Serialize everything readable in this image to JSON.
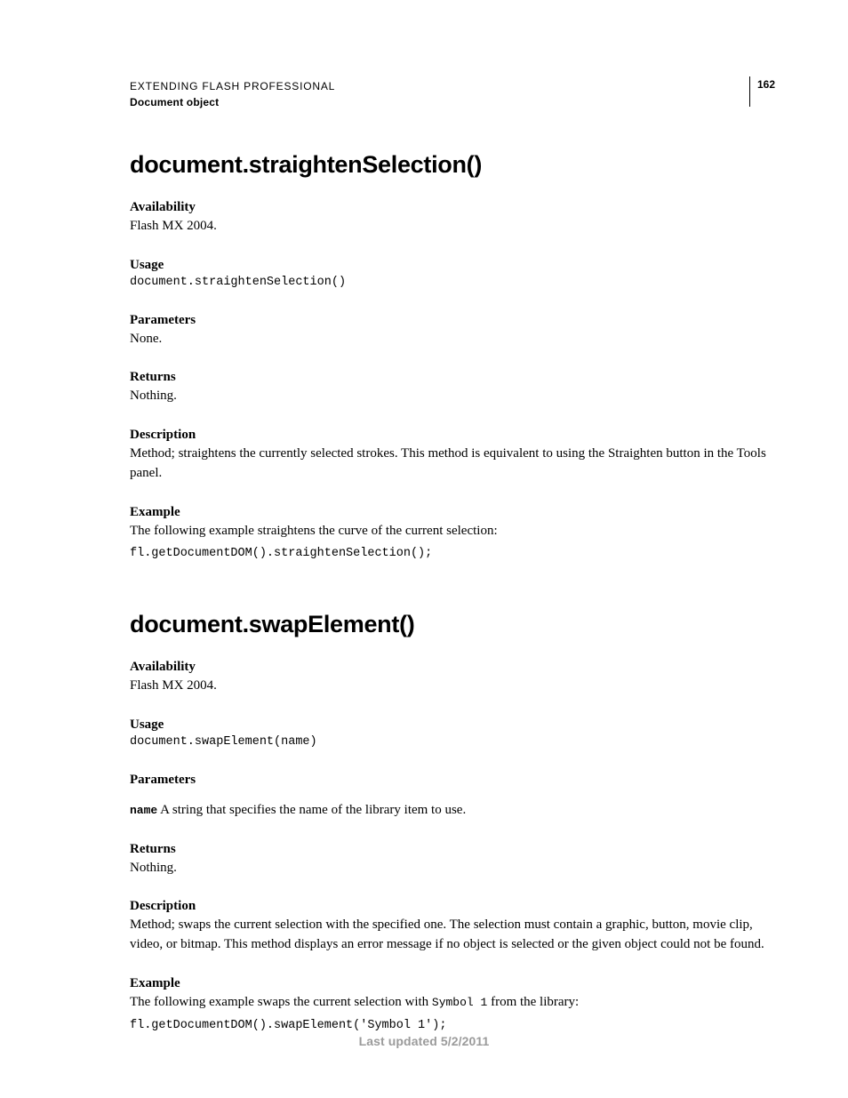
{
  "header": {
    "title": "EXTENDING FLASH PROFESSIONAL",
    "sub": "Document object",
    "page_number": "162"
  },
  "section1": {
    "heading": "document.straightenSelection()",
    "availability_label": "Availability",
    "availability_text": "Flash MX 2004.",
    "usage_label": "Usage",
    "usage_code": "document.straightenSelection()",
    "parameters_label": "Parameters",
    "parameters_text": "None.",
    "returns_label": "Returns",
    "returns_text": "Nothing.",
    "description_label": "Description",
    "description_text": "Method; straightens the currently selected strokes. This method is equivalent to using the Straighten button in the Tools panel.",
    "example_label": "Example",
    "example_text": "The following example straightens the curve of the current selection:",
    "example_code": "fl.getDocumentDOM().straightenSelection();"
  },
  "section2": {
    "heading": "document.swapElement()",
    "availability_label": "Availability",
    "availability_text": "Flash MX 2004.",
    "usage_label": "Usage",
    "usage_code": "document.swapElement(name)",
    "parameters_label": "Parameters",
    "param_name": "name",
    "param_desc": "  A string that specifies the name of the library item to use.",
    "returns_label": "Returns",
    "returns_text": "Nothing.",
    "description_label": "Description",
    "description_text": "Method; swaps the current selection with the specified one. The selection must contain a graphic, button, movie clip, video, or bitmap. This method displays an error message if no object is selected or the given object could not be found.",
    "example_label": "Example",
    "example_text_pre": "The following example swaps the current selection with ",
    "example_inline_code": "Symbol 1",
    "example_text_post": " from the library:",
    "example_code": "fl.getDocumentDOM().swapElement('Symbol 1');"
  },
  "footer": "Last updated 5/2/2011"
}
